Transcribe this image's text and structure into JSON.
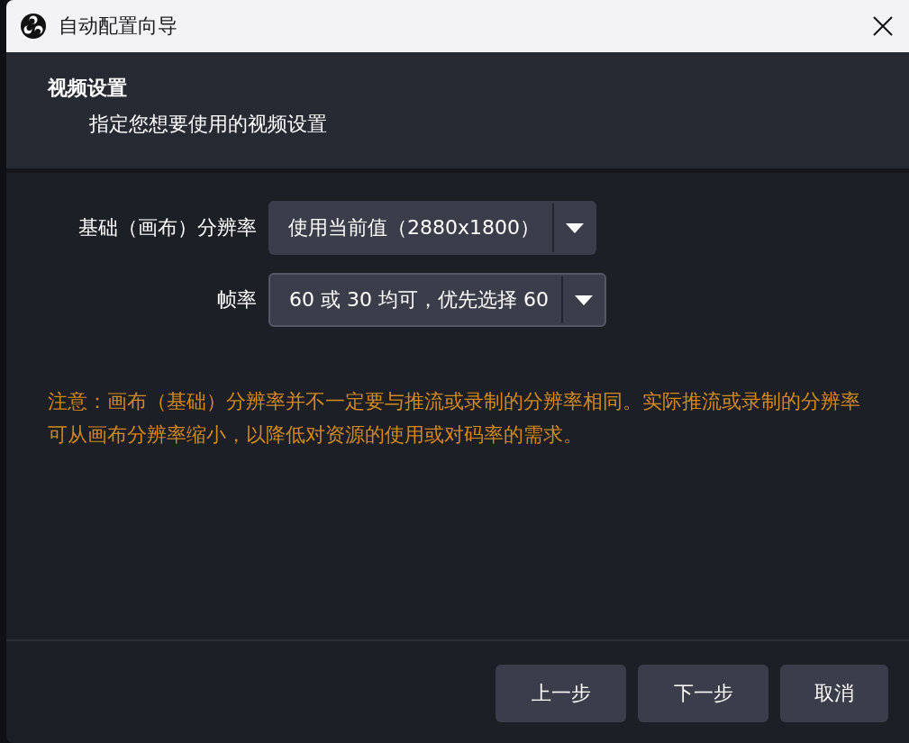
{
  "window": {
    "title": "自动配置向导"
  },
  "header": {
    "title": "视频设置",
    "subtitle": "指定您想要使用的视频设置"
  },
  "fields": [
    {
      "label": "基础（画布）分辨率",
      "value": "使用当前值（2880x1800）",
      "focused": false
    },
    {
      "label": "帧率",
      "value": "60 或 30 均可，优先选择 60",
      "focused": true
    }
  ],
  "note": "注意：画布（基础）分辨率并不一定要与推流或录制的分辨率相同。实际推流或录制的分辨率可从画布分辨率缩小，以降低对资源的使用或对码率的需求。",
  "buttons": [
    {
      "label": "上一步"
    },
    {
      "label": "下一步"
    },
    {
      "label": "取消"
    }
  ]
}
